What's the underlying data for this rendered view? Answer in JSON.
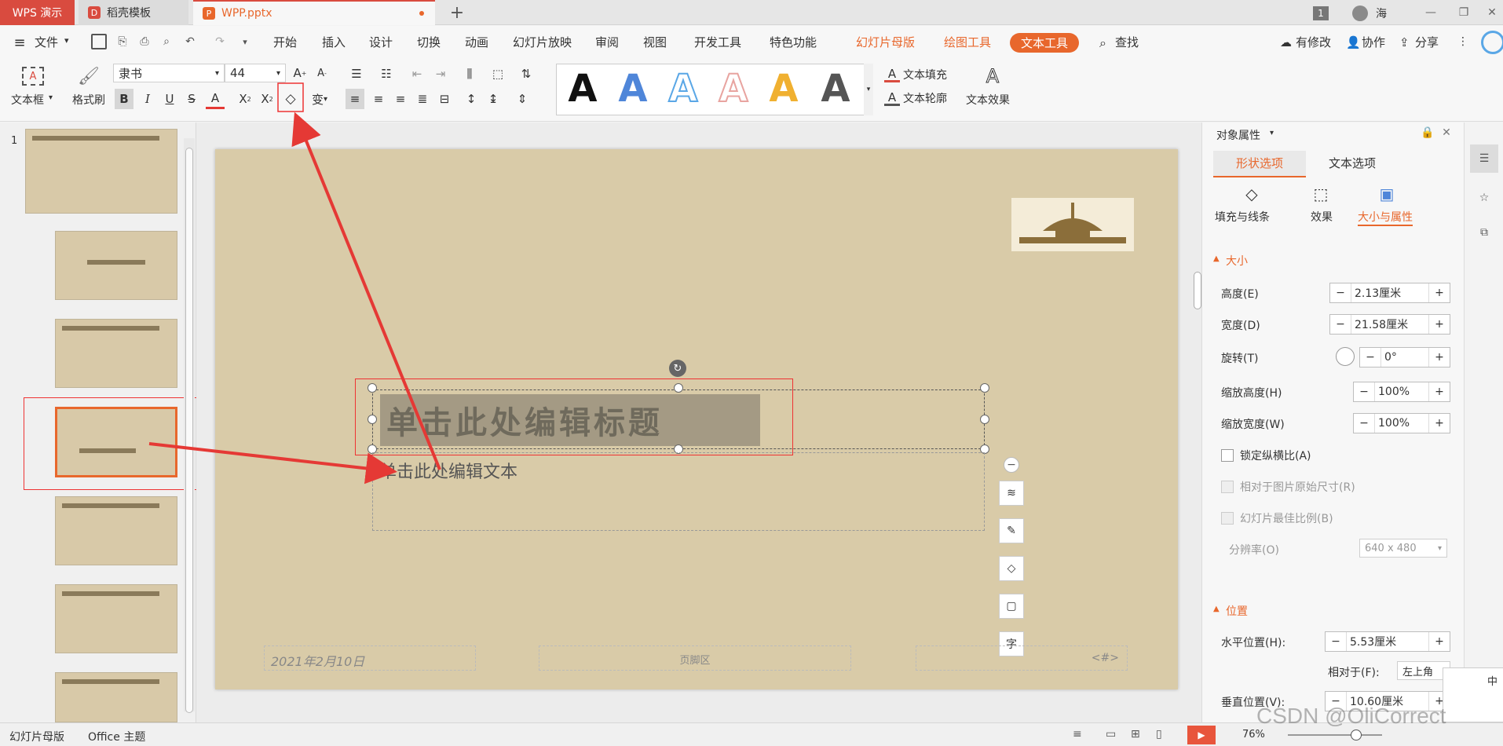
{
  "tabs": {
    "app": "WPS 演示",
    "template": "稻壳模板",
    "file": "WPP.pptx"
  },
  "window": {
    "page_num": "1",
    "user": "海"
  },
  "menu": {
    "file": "文件",
    "items": [
      "开始",
      "插入",
      "设计",
      "切换",
      "动画",
      "幻灯片放映",
      "审阅",
      "视图",
      "开发工具",
      "特色功能"
    ],
    "ctx1": "幻灯片母版",
    "ctx2": "绘图工具",
    "ctx3": "文本工具",
    "search": "查找",
    "modified": "有修改",
    "collab": "协作",
    "share": "分享"
  },
  "ribbon": {
    "textbox": "文本框",
    "format_painter": "格式刷",
    "font": "隶书",
    "size": "44",
    "fill": "文本填充",
    "outline": "文本轮廓",
    "effect": "文本效果",
    "style_colors": [
      "#111111",
      "#4f86d9",
      "#5aa7e6",
      "#e8a4a0",
      "#f0b030",
      "#555555"
    ],
    "style_letter": "A"
  },
  "slides": {
    "first_num": "1"
  },
  "slide": {
    "title": "单击此处编辑标题",
    "body": "单击此处编辑文本",
    "date": "2021年2月10日",
    "footer": "页脚区",
    "number": "<#>"
  },
  "panel": {
    "title": "对象属性",
    "tab_shape": "形状选项",
    "tab_text": "文本选项",
    "sub_fill": "填充与线条",
    "sub_effect": "效果",
    "sub_size": "大小与属性",
    "sec_size": "大小",
    "height_lbl": "高度(E)",
    "height_val": "2.13厘米",
    "width_lbl": "宽度(D)",
    "width_val": "21.58厘米",
    "rotate_lbl": "旋转(T)",
    "rotate_val": "0°",
    "scale_h_lbl": "缩放高度(H)",
    "scale_h_val": "100%",
    "scale_w_lbl": "缩放宽度(W)",
    "scale_w_val": "100%",
    "lock_ratio": "锁定纵横比(A)",
    "rel_orig": "相对于图片原始尺寸(R)",
    "best_scale": "幻灯片最佳比例(B)",
    "resolution_lbl": "分辨率(O)",
    "resolution_val": "640 x 480",
    "sec_pos": "位置",
    "hpos_lbl": "水平位置(H):",
    "hpos_val": "5.53厘米",
    "rel_to": "相对于(F):",
    "rel_to_val": "左上角",
    "vpos_lbl": "垂直位置(V):",
    "vpos_val": "10.60厘米"
  },
  "status": {
    "mode": "幻灯片母版",
    "theme": "Office 主题",
    "zoom": "76%"
  },
  "watermark": "CSDN @OliCorrect"
}
